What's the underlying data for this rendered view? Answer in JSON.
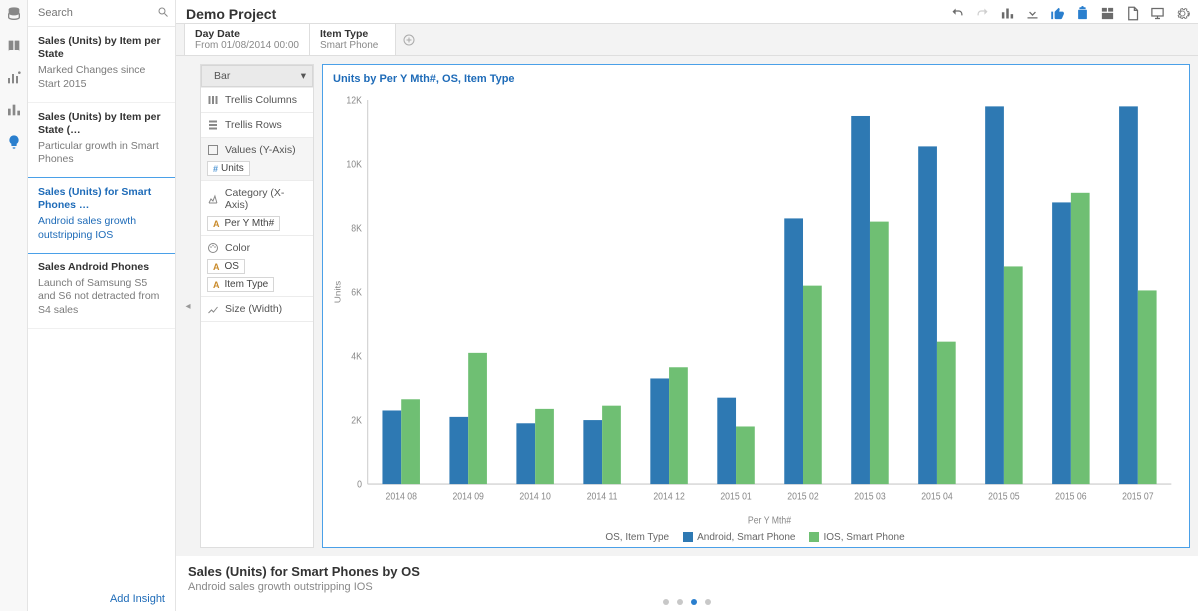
{
  "search": {
    "placeholder": "Search"
  },
  "project_title": "Demo Project",
  "insights": [
    {
      "title": "Sales (Units) by Item per State",
      "desc": "Marked Changes since Start 2015"
    },
    {
      "title": "Sales (Units) by Item per State (…",
      "desc": "Particular growth in Smart Phones"
    },
    {
      "title": "Sales (Units) for Smart Phones …",
      "desc": "Android sales growth outstripping IOS",
      "selected": true
    },
    {
      "title": "Sales Android Phones",
      "desc": "Launch of Samsung S5 and S6 not detracted from S4 sales"
    }
  ],
  "add_insight_label": "Add Insight",
  "tabs": [
    {
      "label": "Day Date",
      "sub": "From 01/08/2014 00:00"
    },
    {
      "label": "Item Type",
      "sub": "Smart Phone"
    }
  ],
  "config": {
    "viz_type": "Bar",
    "trellis_columns_label": "Trellis Columns",
    "trellis_rows_label": "Trellis Rows",
    "values_label": "Values (Y-Axis)",
    "values_pill": "Units",
    "category_label": "Category (X-Axis)",
    "category_pill": "Per Y Mth#",
    "color_label": "Color",
    "color_pill_1": "OS",
    "color_pill_2": "Item Type",
    "size_label": "Size (Width)"
  },
  "chart_title": "Units by Per Y Mth#, OS, Item Type",
  "chart_data": {
    "type": "bar",
    "title": "Units by Per Y Mth#, OS, Item Type",
    "xlabel": "Per Y Mth#",
    "ylabel": "Units",
    "ylim": [
      0,
      12000
    ],
    "yticks": [
      0,
      2000,
      4000,
      6000,
      8000,
      10000,
      12000
    ],
    "ytick_labels": [
      "0",
      "2K",
      "4K",
      "6K",
      "8K",
      "10K",
      "12K"
    ],
    "categories": [
      "2014 08",
      "2014 09",
      "2014 10",
      "2014 11",
      "2014 12",
      "2015 01",
      "2015 02",
      "2015 03",
      "2015 04",
      "2015 05",
      "2015 06",
      "2015 07"
    ],
    "series": [
      {
        "name": "Android, Smart Phone",
        "color": "#2e79b3",
        "values": [
          2300,
          2100,
          1900,
          2000,
          3300,
          2700,
          8300,
          11500,
          10550,
          11800,
          8800,
          11800
        ]
      },
      {
        "name": "IOS, Smart Phone",
        "color": "#6fbf73",
        "values": [
          2650,
          4100,
          2350,
          2450,
          3650,
          1800,
          6200,
          8200,
          4450,
          6800,
          9100,
          6050
        ]
      }
    ],
    "legend_prefix": "OS, Item Type"
  },
  "footer": {
    "title": "Sales (Units) for Smart Phones by OS",
    "desc": "Android sales growth outstripping IOS"
  },
  "pager": {
    "count": 4,
    "active": 2
  }
}
